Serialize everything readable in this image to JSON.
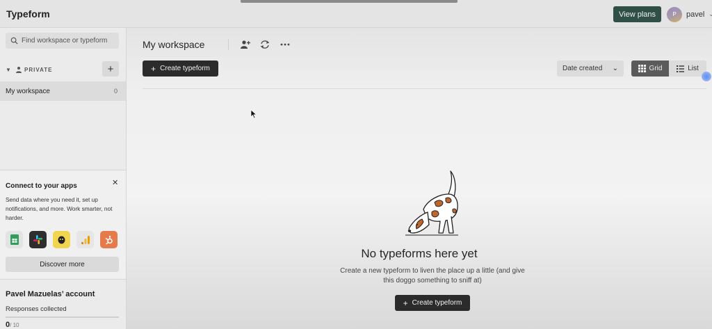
{
  "topbar": {
    "brand": "Typeform",
    "view_plans_label": "View plans",
    "user_initial": "P",
    "user_name": "pavel"
  },
  "sidebar": {
    "search_placeholder": "Find workspace or typeform",
    "section_label": "PRIVATE",
    "add_label": "+",
    "workspaces": [
      {
        "name": "My workspace",
        "count": "0"
      }
    ],
    "connect": {
      "title": "Connect to your apps",
      "description": "Send data where you need it, set up notifications, and more. Work smarter, not harder.",
      "apps": [
        "google-sheets-icon",
        "slack-icon",
        "mailchimp-icon",
        "google-analytics-icon",
        "hubspot-icon"
      ],
      "discover_label": "Discover more"
    },
    "account": {
      "name": "Pavel Mazuelas’ account",
      "responses_label": "Responses collected",
      "responses_value": "0",
      "responses_max": "/ 10"
    }
  },
  "main": {
    "title": "My workspace",
    "create_label": "Create typeform",
    "sort_label": "Date created",
    "view_grid_label": "Grid",
    "view_list_label": "List",
    "empty_title": "No typeforms here yet",
    "empty_desc": "Create a new typeform to liven the place up a little (and give this doggo something to sniff at)",
    "empty_create_label": "Create typeform"
  },
  "colors": {
    "view_plans_bg": "#2f4f47",
    "primary_button": "#2b2b2b",
    "grid_active": "#5b5b5b",
    "dog_spot": "#c0672b"
  }
}
